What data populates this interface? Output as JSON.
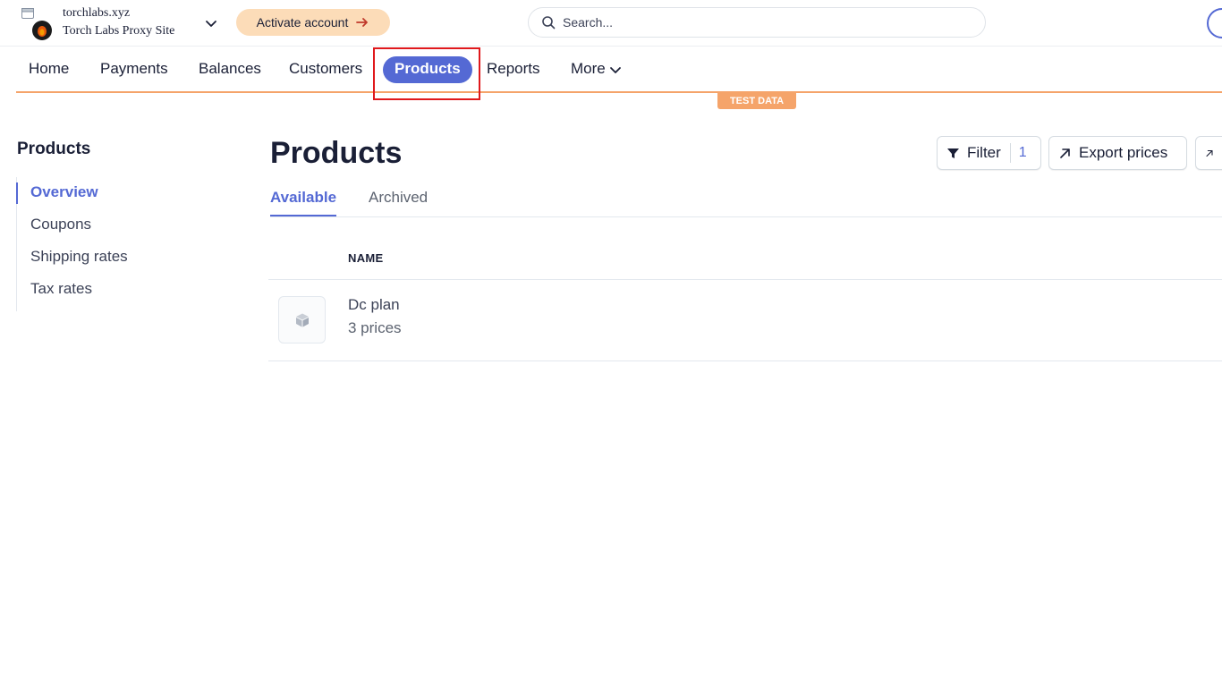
{
  "account": {
    "domain": "torchlabs.xyz",
    "name": "Torch Labs Proxy Site",
    "activate_label": "Activate account"
  },
  "search": {
    "placeholder": "Search..."
  },
  "nav": {
    "items": [
      "Home",
      "Payments",
      "Balances",
      "Customers",
      "Products",
      "Reports",
      "More"
    ],
    "active": "Products"
  },
  "test_badge": "TEST DATA",
  "sidebar": {
    "title": "Products",
    "items": [
      "Overview",
      "Coupons",
      "Shipping rates",
      "Tax rates"
    ],
    "active": "Overview"
  },
  "main": {
    "title": "Products",
    "filter_label": "Filter",
    "filter_count": "1",
    "export_label": "Export prices",
    "tabs": [
      "Available",
      "Archived"
    ],
    "active_tab": "Available",
    "column_header": "NAME",
    "products": [
      {
        "name": "Dc plan",
        "prices": "3 prices"
      }
    ]
  },
  "colors": {
    "accent": "#5469d4",
    "test_mode": "#f5a46a",
    "activate_bg": "#fcdcb8",
    "highlight": "#e0191c"
  }
}
